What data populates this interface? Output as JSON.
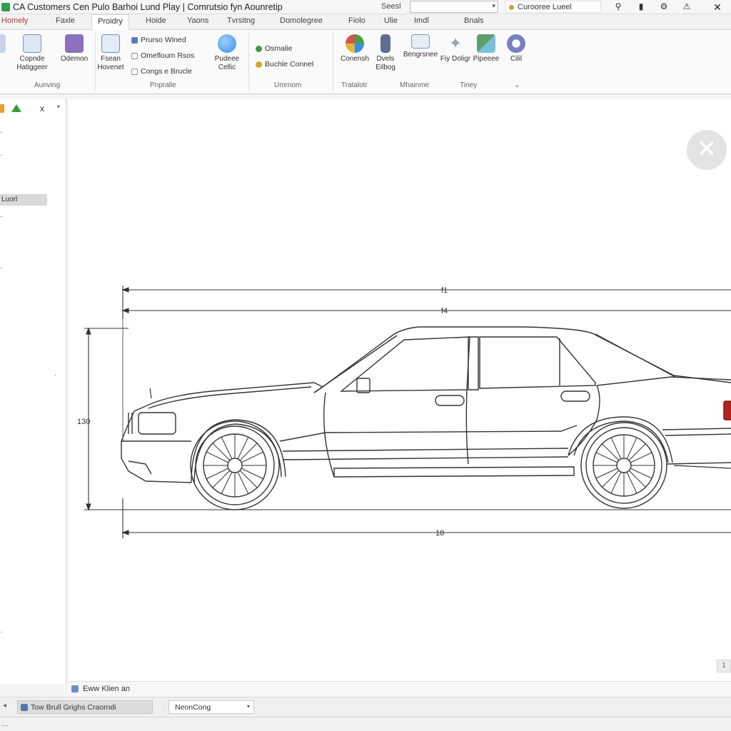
{
  "window": {
    "title": "CA Customers Cen Pulo Barhoi Lund Play | Comrutsio fyn Aounretip",
    "search_label": "Seesl",
    "search_value": "",
    "customer_label": "Curooree Lueel",
    "close_glyph": "✕"
  },
  "tabs": [
    {
      "label": "Homely"
    },
    {
      "label": "Faxle"
    },
    {
      "label": "Proidry"
    },
    {
      "label": "Hoide"
    },
    {
      "label": "Yaons"
    },
    {
      "label": "Tvrsitng"
    },
    {
      "label": "Domolegree"
    },
    {
      "label": "Fiolo"
    },
    {
      "label": "Ulie"
    },
    {
      "label": "Imdl"
    },
    {
      "label": "Bnals"
    }
  ],
  "ribbon": {
    "buttons": [
      {
        "label": "Copnde Hatiggeer",
        "icon": "blueprint-icon",
        "color": "#7b8fc9"
      },
      {
        "label": "Odemon",
        "icon": "folder-icon",
        "color": "#8c6fc0"
      },
      {
        "label": "Fsean Hovenet",
        "icon": "page-icon",
        "color": "#6e8dc8"
      },
      {
        "label": "Pudeee Cellic",
        "icon": "globe-icon",
        "color": "#3a8ee6"
      },
      {
        "label": "Conensh",
        "icon": "palette-icon",
        "color": "#4aa04a"
      },
      {
        "label": "Dvels Eilbog",
        "icon": "bottle-icon",
        "color": "#5d6e8f"
      },
      {
        "label": "Bengrsnee",
        "icon": "monitor-icon",
        "color": "#7c99c2"
      },
      {
        "label": "Fiy Doligr",
        "icon": "star-icon",
        "color": "#9aa2ad"
      },
      {
        "label": "Pipeeee",
        "icon": "pen-icon",
        "color": "#5fa06a"
      },
      {
        "label": "Cilil",
        "icon": "cog-icon",
        "color": "#7a7fc2"
      }
    ],
    "small_items": [
      {
        "label": "Prurso Wined",
        "color": "#5a7bc0"
      },
      {
        "label": "Omefloum Rsos",
        "color": "#7b8b9b"
      },
      {
        "label": "Congs e Brucle",
        "color": "#8a8f96"
      },
      {
        "label": "Osmalie",
        "color": "#3c9a4c"
      },
      {
        "label": "Buchle Connel",
        "color": "#d4a62a"
      }
    ],
    "groups": [
      {
        "label": "Aunving"
      },
      {
        "label": "Pnpralle"
      },
      {
        "label": "Umrnom"
      },
      {
        "label": "Tratalotr"
      },
      {
        "label": "Mhainme"
      },
      {
        "label": "Tiney"
      }
    ]
  },
  "left_panel": {
    "close_glyph": "x",
    "selected_item": "Luorl"
  },
  "drawing": {
    "dim_top_1": "f1",
    "dim_top_2": "f4",
    "dim_height": "130",
    "dim_bottom": "18"
  },
  "status": {
    "line_text": "Eww Klien an",
    "task_label": "Tow Brull Grighs Craorndi",
    "select_value": "NeonCong",
    "scroll_label": "1"
  }
}
